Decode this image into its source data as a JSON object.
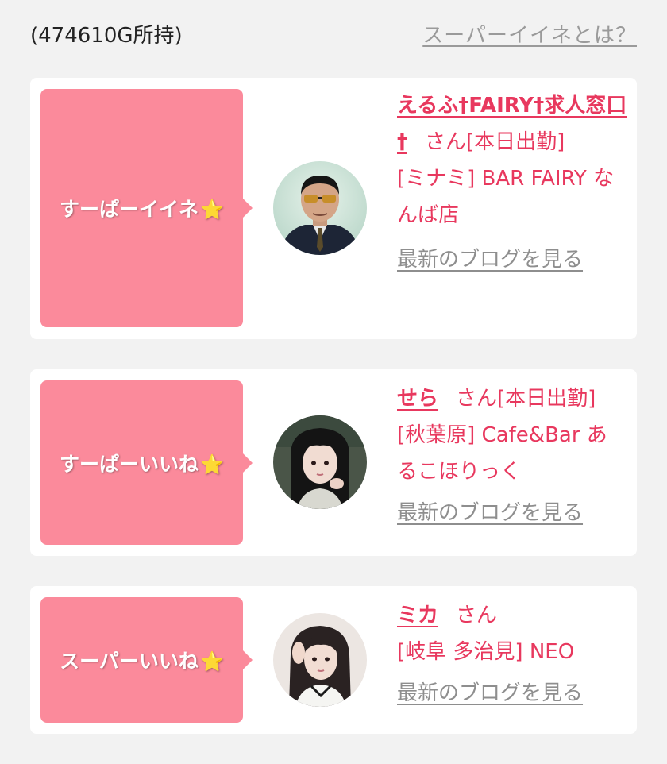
{
  "header": {
    "points": "(474610G所持)",
    "about_link": "スーパーイイネとは？"
  },
  "cards": [
    {
      "badge": "すーぱーイイネ",
      "star": "⭐",
      "name": "えるふ†FAIRY†求人窓口†",
      "honorific": "さん",
      "status": "[本日出勤]",
      "shop": "[ミナミ] BAR FAIRY なんば店",
      "blog_link": "最新のブログを見る"
    },
    {
      "badge": "すーぱーいいね",
      "star": "⭐",
      "name": "せら",
      "honorific": "さん",
      "status": "[本日出勤]",
      "shop": "[秋葉原] Cafe&Bar あるこほりっく",
      "blog_link": "最新のブログを見る"
    },
    {
      "badge": "スーパーいいね",
      "star": "⭐",
      "name": "ミカ",
      "honorific": "さん",
      "status": "",
      "shop": "[岐阜 多治見] NEO",
      "blog_link": "最新のブログを見る"
    }
  ],
  "colors": {
    "badge_bg": "#fb8a9b",
    "accent_text": "#e8385e",
    "link_gray": "#8e8e8e",
    "page_bg": "#f2f2f2"
  }
}
